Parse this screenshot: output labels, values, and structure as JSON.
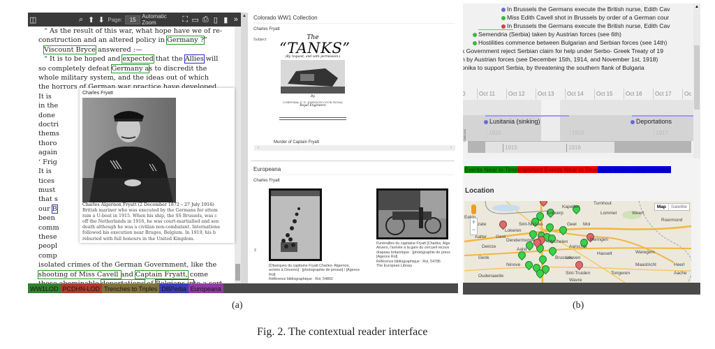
{
  "panel_a": {
    "toolbar": {
      "page_label": "Page:",
      "page_value": "15",
      "zoom_label": "Automatic Zoom"
    },
    "pdf_lines": [
      {
        "segments": [
          {
            "t": "“ As the result of this war, what hope "
          },
          {
            "t": "have we of re-"
          }
        ],
        "indent": true
      },
      {
        "segments": [
          {
            "t": "construction and an altered policy in "
          },
          {
            "t": "Germany ?",
            "h": "g"
          },
          {
            "t": "”"
          }
        ]
      },
      {
        "segments": [
          {
            "t": "Viscount Bryce",
            "h": "g"
          },
          {
            "t": " answered :—"
          }
        ],
        "indent": true
      },
      {
        "segments": [
          {
            "t": "“ It is to be hoped and "
          },
          {
            "t": "expected",
            "h": "g"
          },
          {
            "t": " that the "
          },
          {
            "t": "Allies",
            "h": "b"
          },
          {
            "t": " will"
          }
        ],
        "indent": true
      },
      {
        "segments": [
          {
            "t": "so completely defeat "
          },
          {
            "t": "Germany a",
            "h": "g"
          },
          {
            "t": "s to discredit the"
          }
        ]
      },
      {
        "segments": [
          {
            "t": "whole military system, and the ideas out of which"
          }
        ]
      },
      {
        "segments": [
          {
            "t": "the horrors of German war practice have developed."
          }
        ]
      },
      {
        "segments": [
          {
            "t": "It is"
          }
        ]
      },
      {
        "segments": [
          {
            "t": "in the"
          }
        ]
      },
      {
        "segments": [
          {
            "t": "done"
          }
        ]
      },
      {
        "segments": [
          {
            "t": "doctri"
          }
        ]
      },
      {
        "segments": [
          {
            "t": "thems"
          }
        ]
      },
      {
        "segments": [
          {
            "t": "thoro"
          }
        ]
      },
      {
        "segments": [
          {
            "t": "again"
          }
        ]
      },
      {
        "segments": [
          {
            "t": "‘ Frig"
          }
        ]
      },
      {
        "segments": [
          {
            "t": "It is"
          }
        ]
      },
      {
        "segments": [
          {
            "t": "tices"
          }
        ]
      },
      {
        "segments": [
          {
            "t": "must"
          }
        ]
      },
      {
        "segments": [
          {
            "t": "that s"
          }
        ]
      },
      {
        "segments": [
          {
            "t": "our "
          },
          {
            "t": "B",
            "h": "b"
          }
        ]
      },
      {
        "segments": [
          {
            "t": "been"
          }
        ]
      },
      {
        "segments": [
          {
            "t": "comm"
          }
        ]
      },
      {
        "segments": [
          {
            "t": "these"
          }
        ]
      },
      {
        "segments": [
          {
            "t": "peopl"
          }
        ]
      },
      {
        "segments": [
          {
            "t": "comp"
          }
        ]
      },
      {
        "segments": [
          {
            "t": "isolated crimes of the German Government, like the"
          }
        ]
      },
      {
        "segments": [
          {
            "t": "shooting of Miss Cavell ",
            "h": "g"
          },
          {
            "t": "and "
          },
          {
            "t": "Captain Fryatt,",
            "h": "g"
          },
          {
            "t": " come"
          }
        ]
      },
      {
        "segments": [
          {
            "t": "these abominable "
          },
          {
            "t": "deportations",
            "h": "g"
          },
          {
            "t": " of "
          },
          {
            "t": "Belgians in",
            "h": "b"
          },
          {
            "t": "to a sort"
          }
        ]
      },
      {
        "segments": [
          {
            "t": "of "
          },
          {
            "t": "slavery.",
            "h": "g"
          },
          {
            "t": "”"
          }
        ]
      },
      {
        "segments": [
          {
            "t": "In all communication with "
          },
          {
            "t": "Lord Bryce,",
            "h": "g"
          },
          {
            "t": " one feels the"
          }
        ],
        "indent": true
      }
    ],
    "popup": {
      "title": "Charles Fryatt",
      "caption": [
        "Charles Algernon Fryatt (2 December 1872 – 27 July 1916)",
        "British mariner who was executed by the Germans for attem",
        "ram a U-boat in 1915. When his ship, the SS Brussels, was c",
        "off the Netherlands in 1916, he was court-martialled and sen",
        "death although he was a civilian non-combatant. Internationa",
        "followed his execution near Bruges, Belgium. In 1919, his b",
        "reburied with full honours in the United Kingdom."
      ]
    },
    "source_tabs": [
      {
        "label": "WW1LOD",
        "color": "#2e8b2e"
      },
      {
        "label": "PCDHN-LOD",
        "color": "#c0392b"
      },
      {
        "label": "Trenches to Triples",
        "color": "#8a7a3a"
      },
      {
        "label": "DBPedia",
        "color": "#3a3ac8"
      },
      {
        "label": "Europeana",
        "color": "#9a3ab0"
      }
    ],
    "colorado": {
      "heading": "Colorado WW1 Collection",
      "entity": "Charles Fryatt",
      "subject_label": "Subject",
      "book": {
        "line1": "The",
        "line2": "“TANKS”",
        "line3": "(By request, and with permission.)",
        "line4": "By",
        "line5": "CORPORAL F. D. JOHNSON-COOK ROYAL",
        "line6": "Royal Engineers"
      },
      "item_caption": "Murder of Captain Fryatt"
    },
    "europeana": {
      "heading": "Europeana",
      "entity": "Charles Fryatt",
      "index_marker": "2",
      "items": [
        {
          "caption": [
            "[Obsèques du capitaine Fryatt Charles- Algernon,",
            "arrivée à Douvres] : [photographie de presse] / [Agence",
            "Rol]",
            "Référence bibliographique : Rol, 54802"
          ]
        },
        {
          "caption": [
            "Funérailles du capitaine Fryatt [Charles, Alge",
            "Anvers, l'arrivée à la gare du cercueil recouv",
            "drapeau britannique : [photographie de press",
            "[Agence Rol]",
            "Référence bibliographique : Rol, 54786",
            "The European Library"
          ]
        }
      ]
    },
    "label": "(a)"
  },
  "panel_b": {
    "events": [
      {
        "text": "In Brussels the Germans execute the British nurse, Edith Cav",
        "dot": "#6a6ad8"
      },
      {
        "text": "Miss Edith Cavell shot in Brussels by order of a German cour",
        "dot": "#3ab83a"
      },
      {
        "text": "In Brussels the Germans execute the British nurse, Edith Cav",
        "dot": "#d84040"
      },
      {
        "text": "Semendria (Serbia) taken by Austrian forces (see 6th)",
        "dot": "#3ab83a"
      },
      {
        "text": "Hostilities commence between Bulgarian and Serbian forces (see 14th)",
        "dot": "#3ab83a"
      },
      {
        "text": "k Government reject Serbian claim for help under Serbo- Greek Treaty of 19"
      },
      {
        "text": "n by Austrian forces (see December 15th, 1914, and November 1st, 1918)"
      },
      {
        "text": "onika to support Serbia, by threatening the southern flank of Bulgaria"
      }
    ],
    "day_ticks": [
      "0",
      "Oct 11",
      "Oct 12",
      "Oct 13",
      "Oct 14",
      "Oct 15",
      "Oct 16",
      "Oct 17",
      "Oc"
    ],
    "band_events": [
      {
        "text": "Lusitania (sinking)",
        "dot": "#6a6ad8"
      },
      {
        "text": "Deportations",
        "dot": "#6a6ad8"
      }
    ],
    "year_ticks": [
      "1915",
      "1916",
      "1917"
    ],
    "overview_ticks": [
      "1915",
      "1916"
    ],
    "timeline_credit": "TIMELINE",
    "legend": [
      {
        "label": "Events Near in Time",
        "bg": "#0a8a0a",
        "fg": "#0a3a0a"
      },
      {
        "label": "Important Events Near in Time",
        "bg": "#f00000",
        "fg": "#6a0000"
      },
      {
        "label": "Other Events Near Location",
        "bg": "#0000e0",
        "fg": "#00008a"
      }
    ],
    "location_heading": "Location",
    "map": {
      "type_buttons": [
        "Map",
        "Satellite"
      ],
      "zoom_in": "+",
      "zoom_out": "−",
      "place_names": [
        "Antwerp",
        "Kapellen",
        "Turnhout",
        "Lommel",
        "Weert",
        "Roermond",
        "Sint-Niklaas",
        "Lokeren",
        "Geel",
        "Mol",
        "Gent",
        "Dendermonde",
        "Mechelen",
        "Beringen",
        "Deinze",
        "Aalst",
        "Aarschot",
        "Hasselt",
        "Genk",
        "Waregem",
        "Brussels",
        "Leuven",
        "Maastricht",
        "Heerl",
        "Ninove",
        "Sint-Truiden",
        "Tongeren",
        "Aache",
        "Oudenaarde",
        "Wavre",
        "Eeklo",
        "Aalter",
        "Zelzate"
      ],
      "marker_counts": {
        "green": 20,
        "red": 6
      }
    },
    "label": "(b)"
  },
  "figure_caption": "Fig. 2. The contextual reader interface"
}
